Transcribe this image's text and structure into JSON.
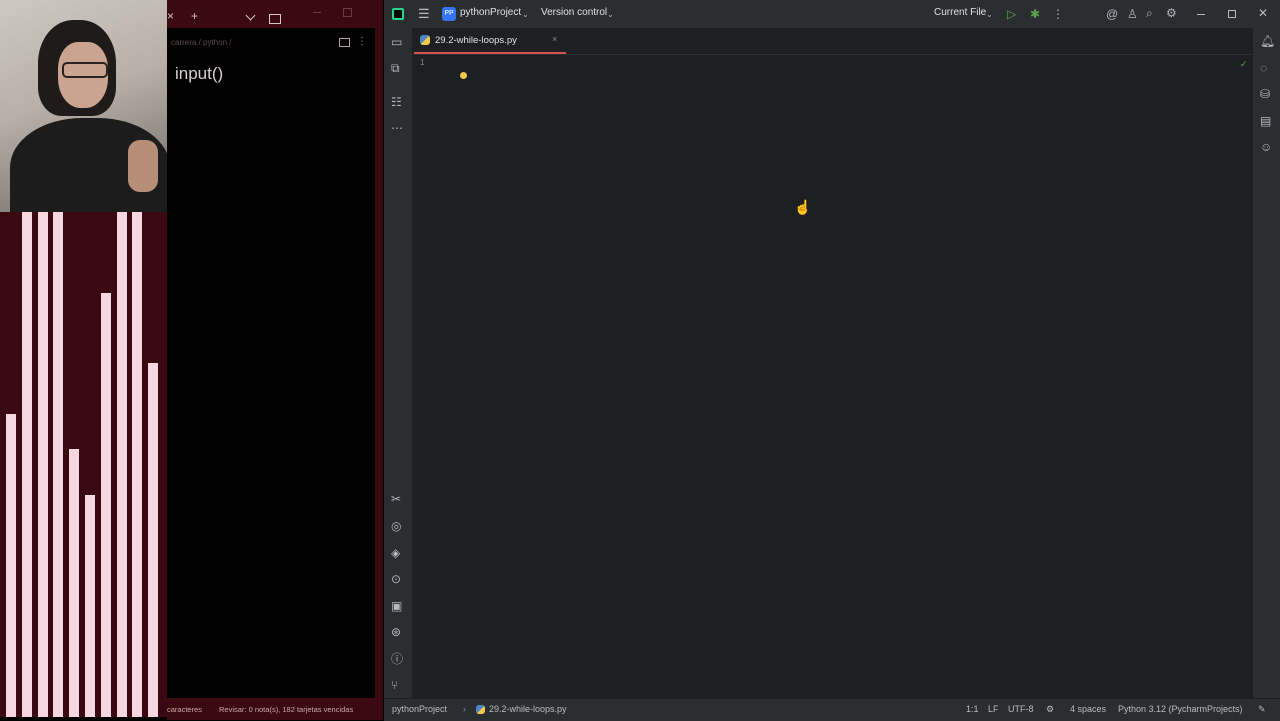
{
  "notes_app": {
    "breadcrumb": "carrera / python /",
    "page_title": "input()",
    "status_left": "caracteres",
    "status_right": "Revisar: 0 nota(s), 182 tarjetas vencidas",
    "tab_close": "×",
    "tab_add": "+"
  },
  "audio_bars": [
    0.6,
    1.0,
    1.0,
    1.0,
    0.53,
    0.44,
    0.84,
    1.0,
    1.0,
    0.7
  ],
  "ide": {
    "project": "pythonProject",
    "project_badge": "PP",
    "vcs": "Version control",
    "run_config": "Current File",
    "tab": {
      "file": "29.2-while-loops.py",
      "close": "×"
    },
    "gutter": {
      "line": "1"
    },
    "status": {
      "breadcrumb_project": "pythonProject",
      "breadcrumb_file": "29.2-while-loops.py",
      "position": "1:1",
      "line_sep": "LF",
      "encoding": "UTF-8",
      "indent": "4 spaces",
      "interpreter": "Python 3.12 (PycharmProjects)"
    },
    "colors": {
      "accent_tab": "#d6524c",
      "editor_bg": "#1e1f22",
      "chrome_bg": "#2b2d30"
    },
    "icons": {
      "title": [
        "app-logo-icon",
        "hamburger-menu-icon",
        "run-icon",
        "debug-icon",
        "more-vertical-icon",
        "ai-assistant-icon",
        "add-user-icon",
        "search-icon",
        "settings-icon",
        "minimize-icon",
        "maximize-icon",
        "close-icon"
      ],
      "left_top": [
        "project-folder-icon",
        "commit-icon",
        "structure-icon",
        "more-horizontal-icon"
      ],
      "left_bottom": [
        "build-tools-icon",
        "python-packages-icon",
        "python-console-icon",
        "services-icon",
        "terminal-icon",
        "problems-icon",
        "info-icon",
        "git-icon"
      ],
      "right": [
        "notifications-icon",
        "ai-chat-icon",
        "database-icon",
        "sciview-icon",
        "copilot-icon"
      ]
    }
  }
}
